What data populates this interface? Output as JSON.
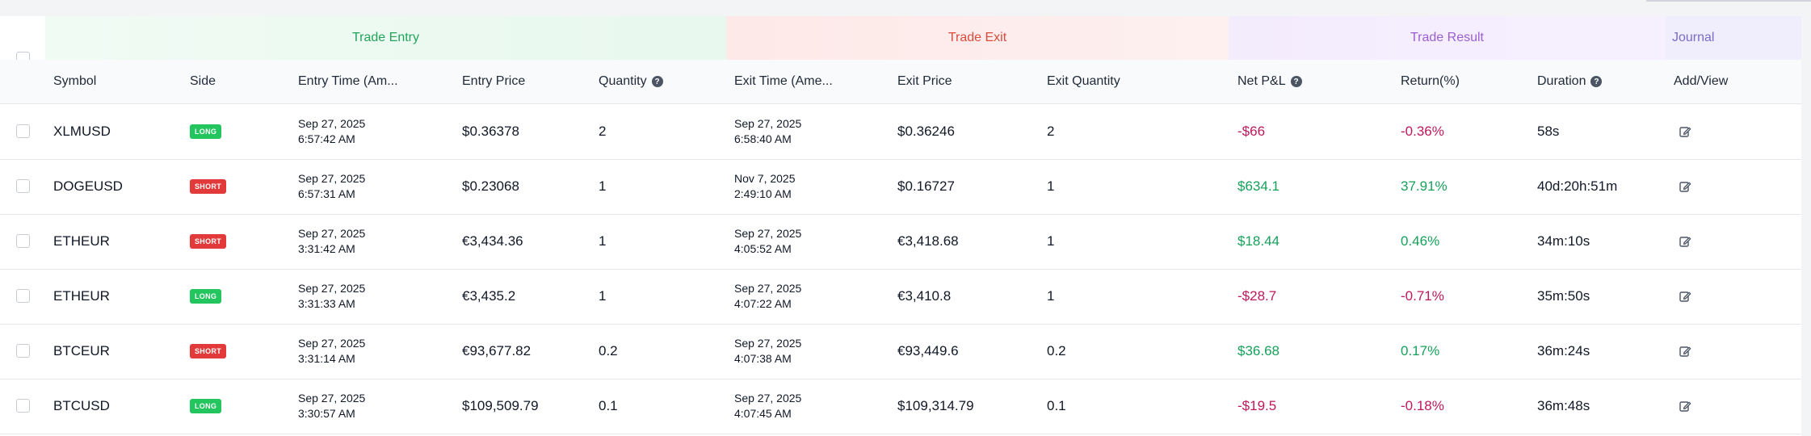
{
  "groups": {
    "entry": "Trade Entry",
    "exit": "Trade Exit",
    "result": "Trade Result",
    "journal": "Journal"
  },
  "columns": {
    "symbol": "Symbol",
    "side": "Side",
    "entry_time": "Entry Time (Am...",
    "entry_price": "Entry Price",
    "quantity": "Quantity",
    "exit_time": "Exit Time (Ame...",
    "exit_price": "Exit Price",
    "exit_quantity": "Exit Quantity",
    "net_pnl": "Net P&L",
    "return": "Return(%)",
    "duration": "Duration",
    "add_view": "Add/View"
  },
  "help_glyph": "?",
  "rows": [
    {
      "symbol": "XLMUSD",
      "side": "LONG",
      "entry_date": "Sep 27, 2025",
      "entry_clock": "6:57:42 AM",
      "entry_price": "$0.36378",
      "quantity": "2",
      "exit_date": "Sep 27, 2025",
      "exit_clock": "6:58:40 AM",
      "exit_price": "$0.36246",
      "exit_quantity": "2",
      "net_pnl": "-$66",
      "return": "-0.36%",
      "duration": "58s",
      "positive": false
    },
    {
      "symbol": "DOGEUSD",
      "side": "SHORT",
      "entry_date": "Sep 27, 2025",
      "entry_clock": "6:57:31 AM",
      "entry_price": "$0.23068",
      "quantity": "1",
      "exit_date": "Nov 7, 2025",
      "exit_clock": "2:49:10 AM",
      "exit_price": "$0.16727",
      "exit_quantity": "1",
      "net_pnl": "$634.1",
      "return": "37.91%",
      "duration": "40d:20h:51m",
      "positive": true
    },
    {
      "symbol": "ETHEUR",
      "side": "SHORT",
      "entry_date": "Sep 27, 2025",
      "entry_clock": "3:31:42 AM",
      "entry_price": "€3,434.36",
      "quantity": "1",
      "exit_date": "Sep 27, 2025",
      "exit_clock": "4:05:52 AM",
      "exit_price": "€3,418.68",
      "exit_quantity": "1",
      "net_pnl": "$18.44",
      "return": "0.46%",
      "duration": "34m:10s",
      "positive": true
    },
    {
      "symbol": "ETHEUR",
      "side": "LONG",
      "entry_date": "Sep 27, 2025",
      "entry_clock": "3:31:33 AM",
      "entry_price": "€3,435.2",
      "quantity": "1",
      "exit_date": "Sep 27, 2025",
      "exit_clock": "4:07:22 AM",
      "exit_price": "€3,410.8",
      "exit_quantity": "1",
      "net_pnl": "-$28.7",
      "return": "-0.71%",
      "duration": "35m:50s",
      "positive": false
    },
    {
      "symbol": "BTCEUR",
      "side": "SHORT",
      "entry_date": "Sep 27, 2025",
      "entry_clock": "3:31:14 AM",
      "entry_price": "€93,677.82",
      "quantity": "0.2",
      "exit_date": "Sep 27, 2025",
      "exit_clock": "4:07:38 AM",
      "exit_price": "€93,449.6",
      "exit_quantity": "0.2",
      "net_pnl": "$36.68",
      "return": "0.17%",
      "duration": "36m:24s",
      "positive": true
    },
    {
      "symbol": "BTCUSD",
      "side": "LONG",
      "entry_date": "Sep 27, 2025",
      "entry_clock": "3:30:57 AM",
      "entry_price": "$109,509.79",
      "quantity": "0.1",
      "exit_date": "Sep 27, 2025",
      "exit_clock": "4:07:45 AM",
      "exit_price": "$109,314.79",
      "exit_quantity": "0.1",
      "net_pnl": "-$19.5",
      "return": "-0.18%",
      "duration": "36m:48s",
      "positive": false
    }
  ],
  "colors": {
    "positive": "#16a05a",
    "negative": "#be185d",
    "long_badge": "#22c55e",
    "short_badge": "#e23a3a"
  },
  "icons": {
    "help": "help-circle-icon",
    "edit": "edit-icon",
    "checkbox": "checkbox"
  }
}
